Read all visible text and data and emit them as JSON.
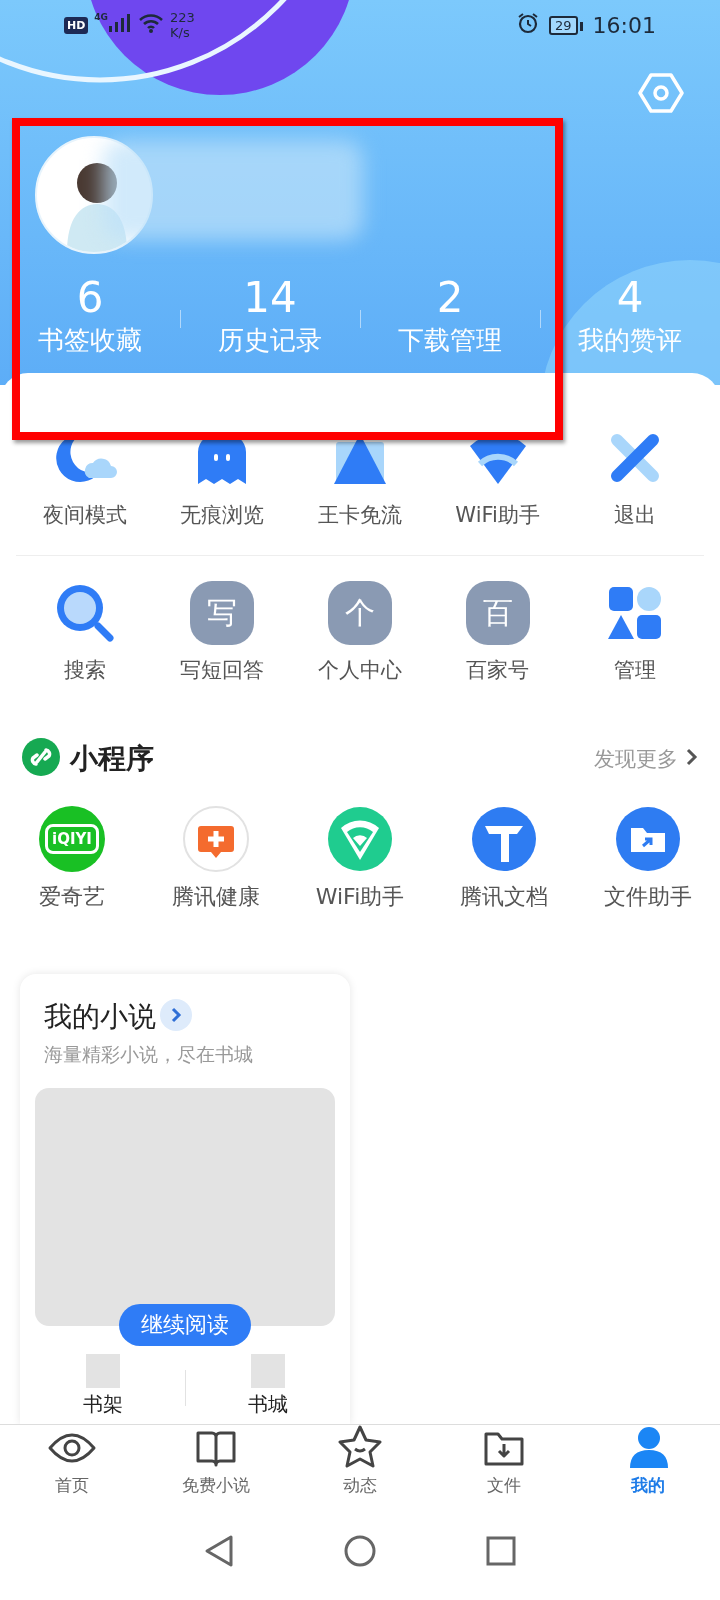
{
  "status_bar": {
    "hd_badge": "HD",
    "network_type": "4G",
    "speed_value": "223",
    "speed_unit": "K/s",
    "battery": "29",
    "time": "16:01"
  },
  "stats": [
    {
      "value": "6",
      "label": "书签收藏"
    },
    {
      "value": "14",
      "label": "历史记录"
    },
    {
      "value": "2",
      "label": "下载管理"
    },
    {
      "value": "4",
      "label": "我的赞评"
    }
  ],
  "tool_rows": [
    {
      "items": [
        {
          "label": "夜间模式"
        },
        {
          "label": "无痕浏览"
        },
        {
          "label": "王卡免流"
        },
        {
          "label": "WiFi助手"
        },
        {
          "label": "退出"
        }
      ]
    },
    {
      "items": [
        {
          "label": "搜索"
        },
        {
          "label": "写短回答",
          "glyph": "写"
        },
        {
          "label": "个人中心",
          "glyph": "个"
        },
        {
          "label": "百家号",
          "glyph": "百"
        },
        {
          "label": "管理"
        }
      ]
    }
  ],
  "mini_programs": {
    "title": "小程序",
    "more": "发现更多",
    "items": [
      {
        "label": "爱奇艺",
        "glyph": "iQIYI"
      },
      {
        "label": "腾讯健康"
      },
      {
        "label": "WiFi助手"
      },
      {
        "label": "腾讯文档"
      },
      {
        "label": "文件助手"
      }
    ]
  },
  "novel_card": {
    "title": "我的小说",
    "subtitle": "海量精彩小说，尽在书城",
    "button": "继续阅读",
    "links": [
      "书架",
      "书城"
    ]
  },
  "bottom_nav": [
    {
      "label": "首页",
      "selected": false
    },
    {
      "label": "免费小说",
      "selected": false
    },
    {
      "label": "动态",
      "selected": false
    },
    {
      "label": "文件",
      "selected": false
    },
    {
      "label": "我的",
      "selected": true
    }
  ]
}
